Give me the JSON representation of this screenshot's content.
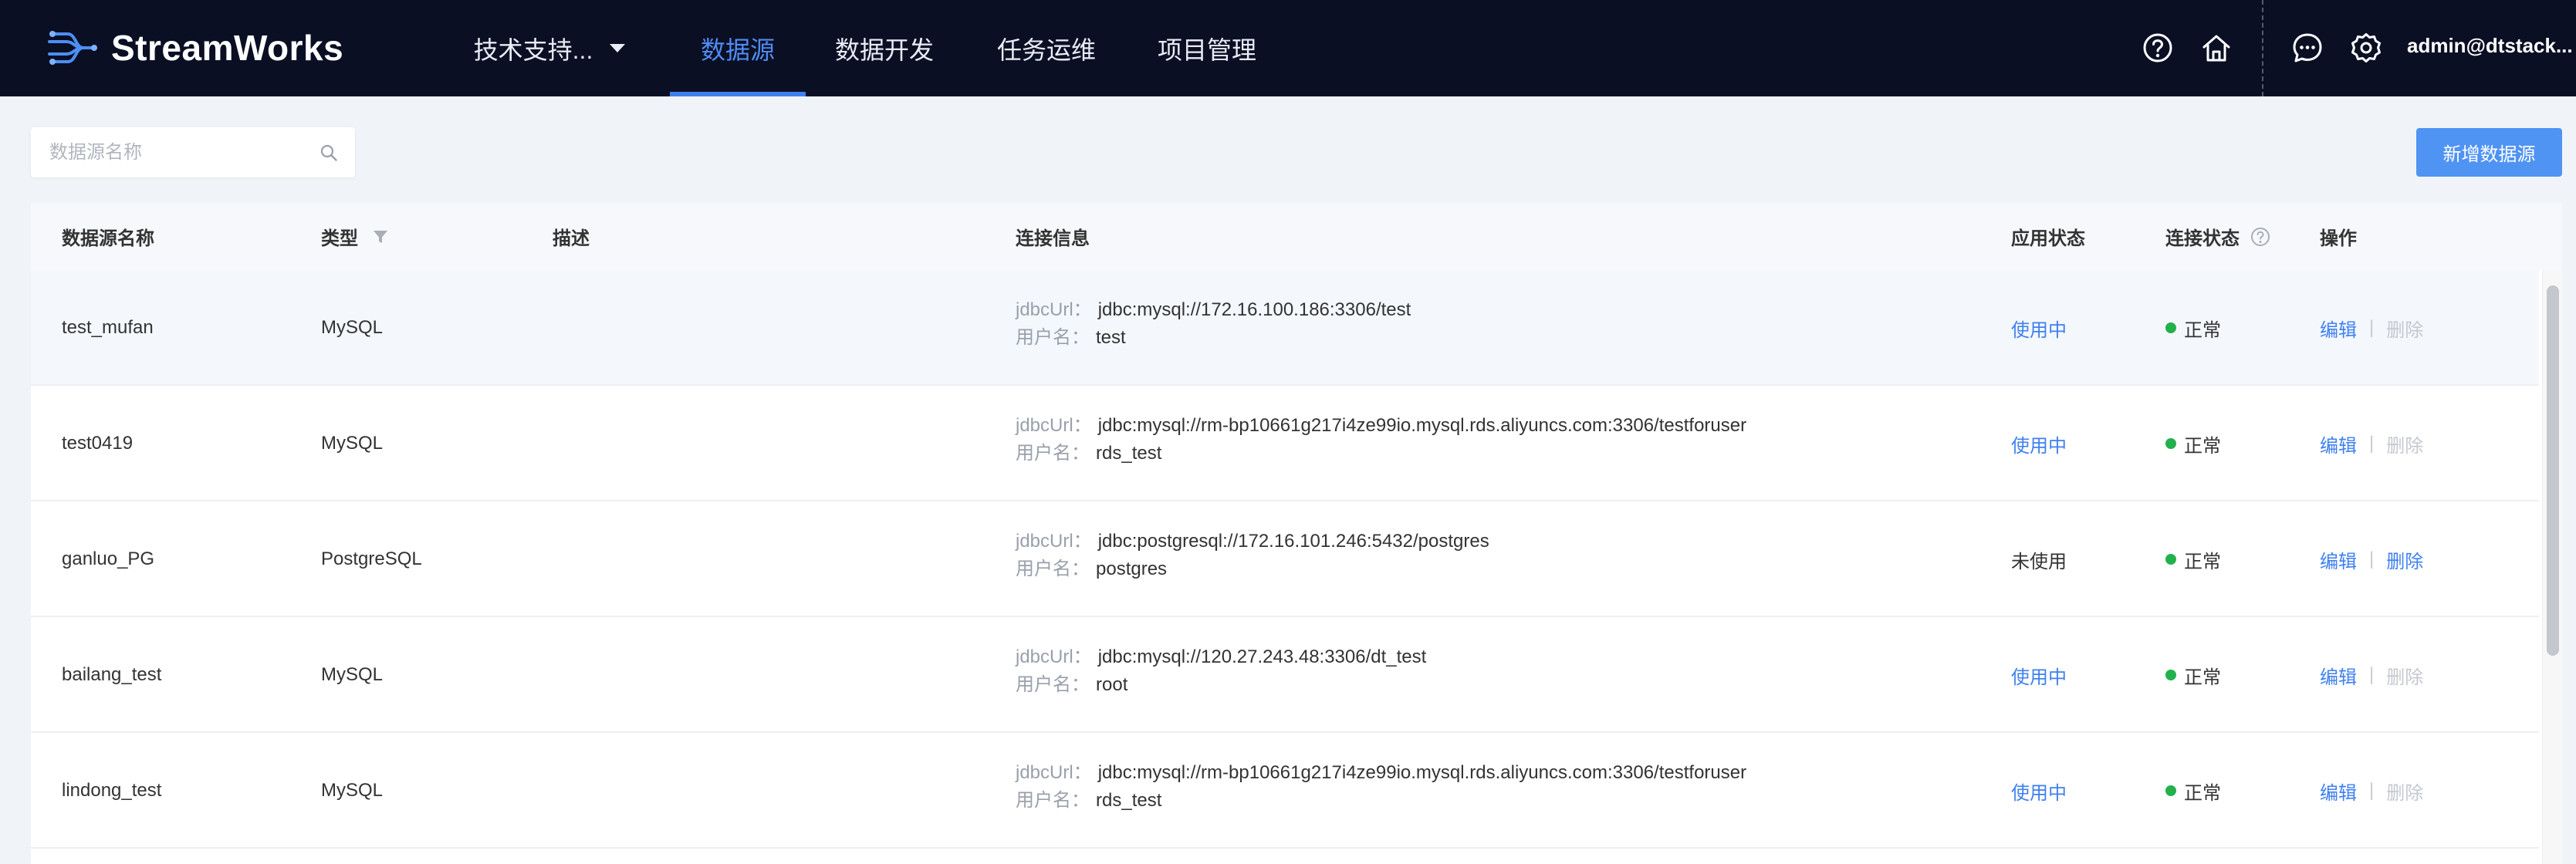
{
  "app": {
    "brand": "StreamWorks",
    "nav": [
      {
        "label": "技术支持...",
        "active": false
      },
      {
        "label": "数据源",
        "active": true
      },
      {
        "label": "数据开发",
        "active": false
      },
      {
        "label": "任务运维",
        "active": false
      },
      {
        "label": "项目管理",
        "active": false
      }
    ],
    "header_icons": [
      "help-icon",
      "home-icon",
      "message-icon",
      "gear-icon"
    ],
    "user": "admin@dtstack..."
  },
  "toolbar": {
    "search_placeholder": "数据源名称",
    "search_value": "",
    "add_label": "新增数据源"
  },
  "table": {
    "columns": {
      "name": "数据源名称",
      "type": "类型",
      "desc": "描述",
      "conn": "连接信息",
      "app_status": "应用状态",
      "conn_status": "连接状态",
      "ops": "操作"
    },
    "conn_labels": {
      "url": "jdbcUrl：",
      "user": "用户名："
    },
    "op_labels": {
      "edit": "编辑",
      "delete": "删除",
      "sep": "|"
    },
    "rows": [
      {
        "name": "test_mufan",
        "type": "MySQL",
        "desc": "",
        "url": "jdbc:mysql://172.16.100.186:3306/test",
        "user": "test",
        "app_status": "使用中",
        "conn_status": "正常",
        "delete_enabled": false
      },
      {
        "name": "test0419",
        "type": "MySQL",
        "desc": "",
        "url": "jdbc:mysql://rm-bp10661g217i4ze99io.mysql.rds.aliyuncs.com:3306/testforuser",
        "user": "rds_test",
        "app_status": "使用中",
        "conn_status": "正常",
        "delete_enabled": false
      },
      {
        "name": "ganluo_PG",
        "type": "PostgreSQL",
        "desc": "",
        "url": "jdbc:postgresql://172.16.101.246:5432/postgres",
        "user": "postgres",
        "app_status": "未使用",
        "conn_status": "正常",
        "delete_enabled": true
      },
      {
        "name": "bailang_test",
        "type": "MySQL",
        "desc": "",
        "url": "jdbc:mysql://120.27.243.48:3306/dt_test",
        "user": "root",
        "app_status": "使用中",
        "conn_status": "正常",
        "delete_enabled": false
      },
      {
        "name": "lindong_test",
        "type": "MySQL",
        "desc": "",
        "url": "jdbc:mysql://rm-bp10661g217i4ze99io.mysql.rds.aliyuncs.com:3306/testforuser",
        "user": "rds_test",
        "app_status": "使用中",
        "conn_status": "正常",
        "delete_enabled": false
      }
    ]
  },
  "colors": {
    "header_bg": "#0b0f24",
    "accent": "#3f80ee",
    "ok": "#22b14c"
  }
}
